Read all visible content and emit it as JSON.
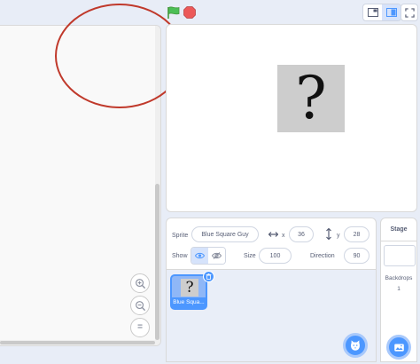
{
  "code_area": {
    "zoom_in_icon": "zoom-in-icon",
    "zoom_out_icon": "zoom-out-icon",
    "zoom_reset_icon": "zoom-reset-icon",
    "zoom_reset_glyph": "="
  },
  "controls": {
    "flag_icon": "green-flag-icon",
    "stop_icon": "stop-icon",
    "flag_color": "#4cbf56",
    "stop_color": "#ec5959"
  },
  "stage": {
    "sprite_glyph": "?"
  },
  "sprite_info": {
    "sprite_label": "Sprite",
    "sprite_name": "Blue Square Guy",
    "x_label": "x",
    "x_value": "36",
    "y_label": "y",
    "y_value": "28",
    "show_label": "Show",
    "size_label": "Size",
    "size_value": "100",
    "direction_label": "Direction",
    "direction_value": "90"
  },
  "sprite_list": {
    "tiles": [
      {
        "name": "Blue Squa...",
        "glyph": "?"
      }
    ]
  },
  "stage_panel": {
    "title": "Stage",
    "backdrops_label": "Backdrops",
    "backdrops_count": "1"
  },
  "colors": {
    "accent": "#4c97ff",
    "annotation": "#c0392b"
  }
}
